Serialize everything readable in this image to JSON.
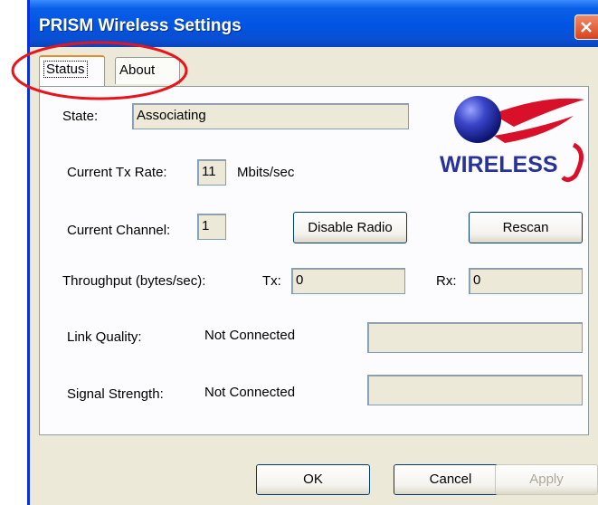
{
  "window": {
    "title": "PRISM Wireless Settings"
  },
  "tabs": [
    {
      "label": "Status"
    },
    {
      "label": "About"
    }
  ],
  "status": {
    "state_label": "State:",
    "state_value": "Associating",
    "tx_rate_label": "Current Tx Rate:",
    "tx_rate_value": "11",
    "tx_rate_unit": "Mbits/sec",
    "channel_label": "Current Channel:",
    "channel_value": "1",
    "disable_radio_label": "Disable Radio",
    "rescan_label": "Rescan",
    "throughput_label": "Throughput (bytes/sec):",
    "tx_label": "Tx:",
    "tx_value": "0",
    "rx_label": "Rx:",
    "rx_value": "0",
    "link_quality_label": "Link Quality:",
    "link_quality_value": "Not Connected",
    "signal_strength_label": "Signal Strength:",
    "signal_strength_value": "Not Connected"
  },
  "logo": {
    "text": "WIRELESS"
  },
  "buttons": {
    "ok": "OK",
    "cancel": "Cancel",
    "apply": "Apply"
  },
  "colors": {
    "titlebar": "#0054e3",
    "annotation_circle": "#e8141c",
    "logo_red": "#d8102a",
    "logo_blue": "#27339a"
  },
  "icons": {
    "close": "close-icon",
    "logo": "wireless-logo-icon"
  }
}
